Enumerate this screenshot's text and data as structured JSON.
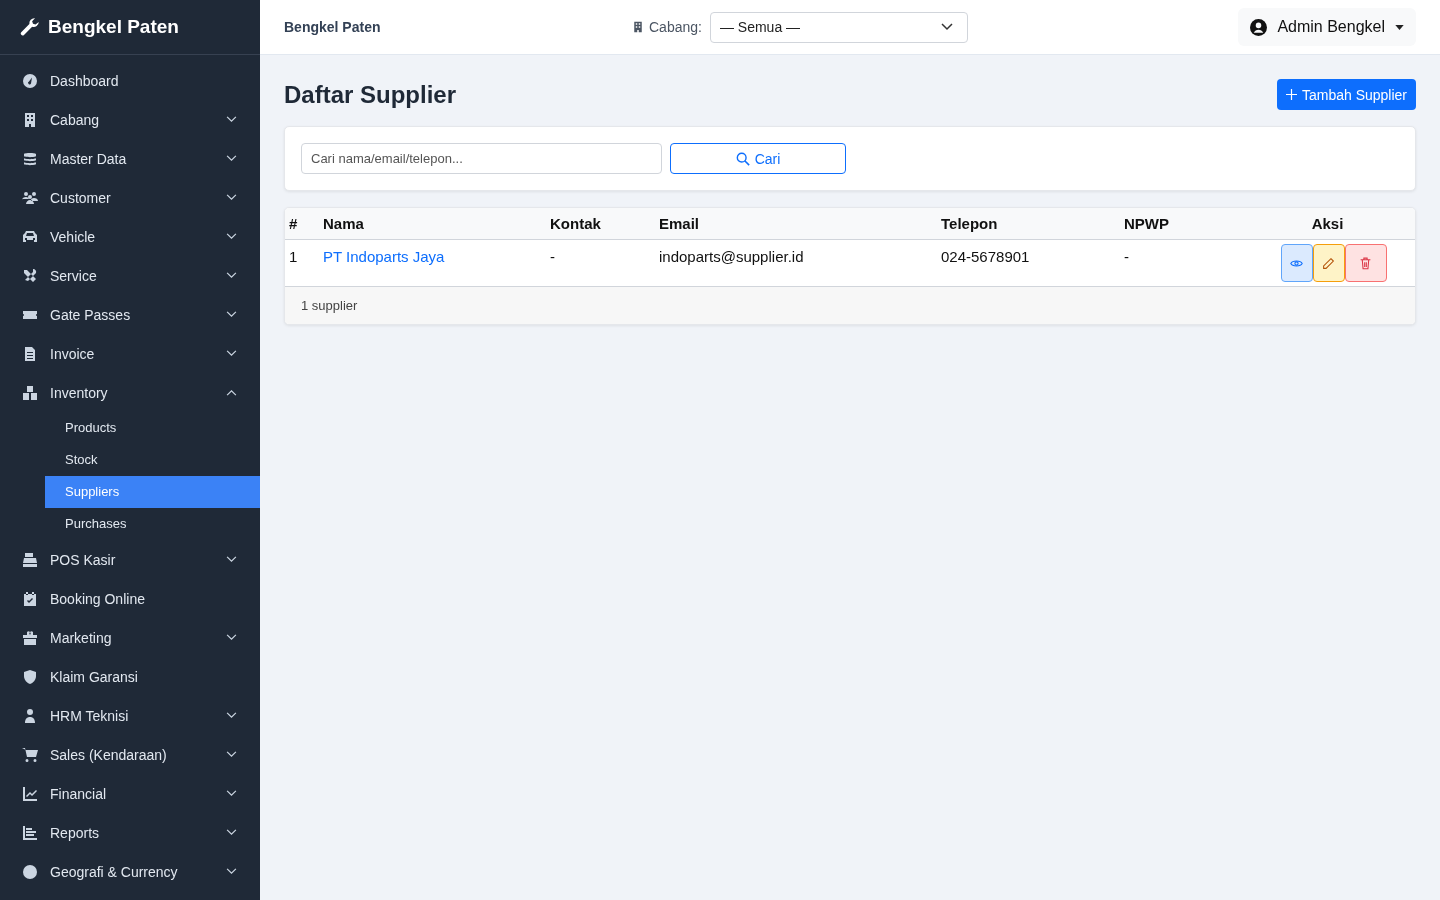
{
  "sidebar": {
    "brand": "Bengkel Paten",
    "items": [
      {
        "label": "Dashboard"
      },
      {
        "label": "Cabang",
        "expanded": false
      },
      {
        "label": "Master Data",
        "expanded": false
      },
      {
        "label": "Customer",
        "expanded": false
      },
      {
        "label": "Vehicle",
        "expanded": false
      },
      {
        "label": "Service",
        "expanded": false
      },
      {
        "label": "Gate Passes",
        "expanded": false
      },
      {
        "label": "Invoice",
        "expanded": false
      },
      {
        "label": "Inventory",
        "expanded": true,
        "children": [
          {
            "label": "Products",
            "selected": false
          },
          {
            "label": "Stock",
            "selected": false
          },
          {
            "label": "Suppliers",
            "selected": true
          },
          {
            "label": "Purchases",
            "selected": false
          }
        ]
      },
      {
        "label": "POS Kasir",
        "expanded": false
      },
      {
        "label": "Booking Online"
      },
      {
        "label": "Marketing",
        "expanded": false
      },
      {
        "label": "Klaim Garansi"
      },
      {
        "label": "HRM Teknisi",
        "expanded": false
      },
      {
        "label": "Sales (Kendaraan)",
        "expanded": false
      },
      {
        "label": "Financial",
        "expanded": false
      },
      {
        "label": "Reports",
        "expanded": false
      },
      {
        "label": "Geografi & Currency",
        "expanded": false
      }
    ]
  },
  "header": {
    "title": "Bengkel Paten",
    "branch_label": "Cabang:",
    "branch_value": "— Semua —",
    "user": "Admin Bengkel"
  },
  "page": {
    "title": "Daftar Supplier",
    "add_button": "Tambah Supplier"
  },
  "search": {
    "placeholder": "Cari nama/email/telepon...",
    "button": "Cari"
  },
  "table": {
    "columns": [
      "#",
      "Nama",
      "Kontak",
      "Email",
      "Telepon",
      "NPWP",
      "Aksi"
    ],
    "rows": [
      {
        "no": "1",
        "name": "PT Indoparts Jaya",
        "contact": "-",
        "email": "indoparts@supplier.id",
        "phone": "024-5678901",
        "npwp": "-",
        "actions": [
          {
            "kind": "view"
          },
          {
            "kind": "edit"
          },
          {
            "kind": "delete"
          }
        ]
      }
    ],
    "footer": "1 supplier"
  }
}
